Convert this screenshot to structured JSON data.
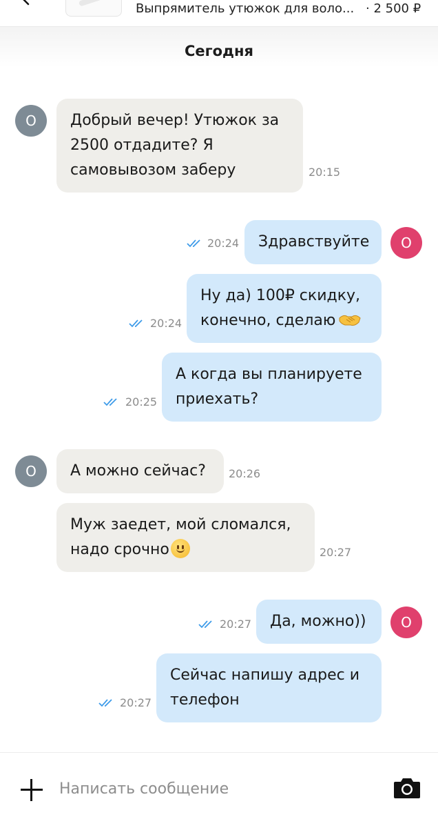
{
  "listing": {
    "title": "Выпрямитель утюжок для воло...",
    "price": "· 2 500 ₽"
  },
  "chat": {
    "day_label": "Сегодня",
    "messages": [
      {
        "from": "them",
        "avatar": "О",
        "lines": [
          "Добрый вечер! Утюжок за",
          "2500 отдадите? Я",
          "самовывозом заберу"
        ],
        "time": "20:15"
      },
      {
        "from": "me",
        "avatar": "О",
        "lines": [
          "Здравствуйте"
        ],
        "time": "20:24",
        "status": "read"
      },
      {
        "from": "me",
        "lines": [
          "Ну да) 100₽ скидку,",
          "конечно, сделаю"
        ],
        "emoji": "handshake-emoji",
        "time": "20:24",
        "status": "read"
      },
      {
        "from": "me",
        "lines": [
          "А когда вы планируете",
          "приехать?"
        ],
        "time": "20:25",
        "status": "read"
      },
      {
        "from": "them",
        "avatar": "О",
        "lines": [
          "А можно сейчас?"
        ],
        "time": "20:26"
      },
      {
        "from": "them",
        "lines": [
          "Муж заедет, мой сломался,",
          "надо срочно"
        ],
        "emoji": "slight-smile-emoji",
        "time": "20:27"
      },
      {
        "from": "me",
        "avatar": "О",
        "lines": [
          "Да, можно))"
        ],
        "time": "20:27",
        "status": "read"
      },
      {
        "from": "me",
        "lines": [
          "Сейчас напишу адрес и",
          "телефон"
        ],
        "time": "20:27",
        "status": "read"
      }
    ]
  },
  "composer": {
    "placeholder": "Написать сообщение",
    "attach_icon": "plus-icon",
    "camera_icon": "camera-icon"
  },
  "colors": {
    "incoming_bubble": "#efeeea",
    "outgoing_bubble": "#d3e9fb",
    "their_avatar": "#7e8b95",
    "my_avatar": "#e0406d",
    "read_ticks": "#3d9be9"
  }
}
